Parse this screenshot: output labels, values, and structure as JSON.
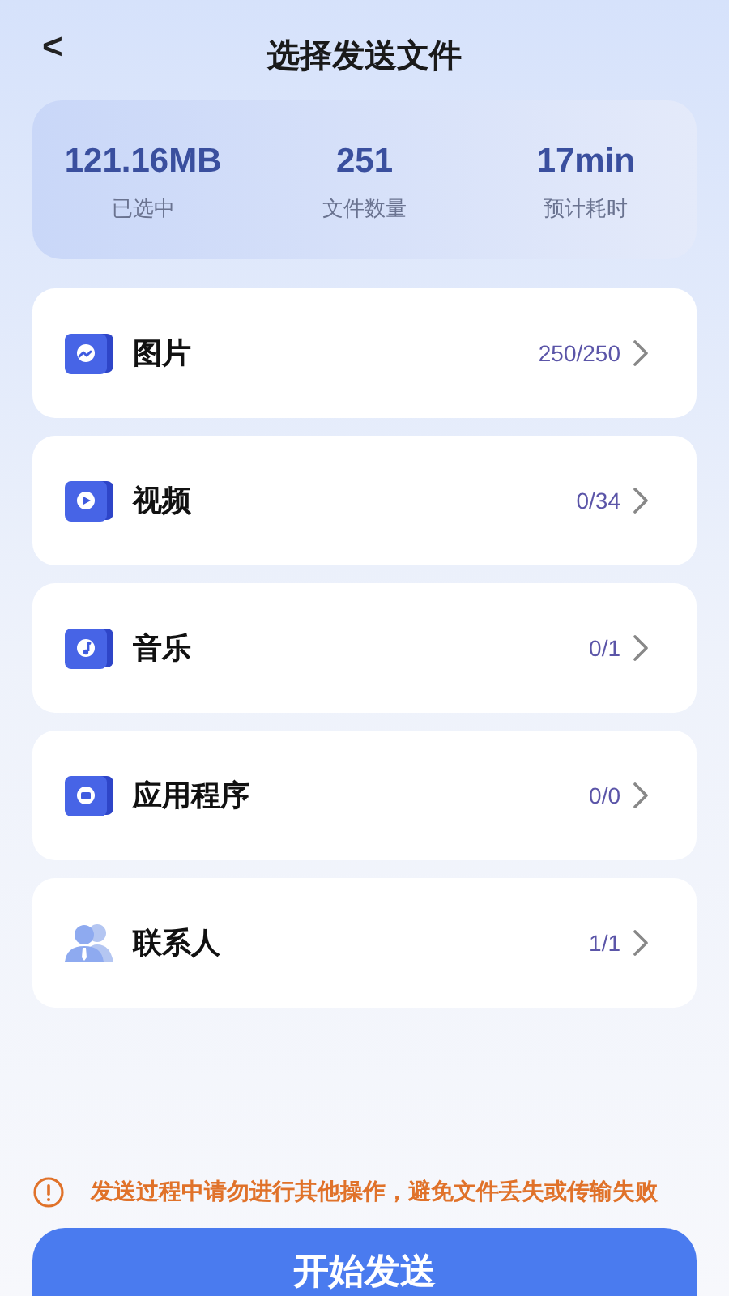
{
  "header": {
    "back": "<",
    "title": "选择发送文件"
  },
  "stats": [
    {
      "value": "121.16MB",
      "label": "已选中"
    },
    {
      "value": "251",
      "label": "文件数量"
    },
    {
      "value": "17min",
      "label": "预计耗时"
    }
  ],
  "categories": [
    {
      "kind": "photo",
      "name": "图片",
      "count": "250/250"
    },
    {
      "kind": "video",
      "name": "视频",
      "count": "0/34"
    },
    {
      "kind": "music",
      "name": "音乐",
      "count": "0/1"
    },
    {
      "kind": "app",
      "name": "应用程序",
      "count": "0/0"
    },
    {
      "kind": "contacts",
      "name": "联系人",
      "count": "1/1"
    }
  ],
  "warning": "发送过程中请勿进行其他操作，避免文件丢失或传输失败",
  "start_button": "开始发送"
}
